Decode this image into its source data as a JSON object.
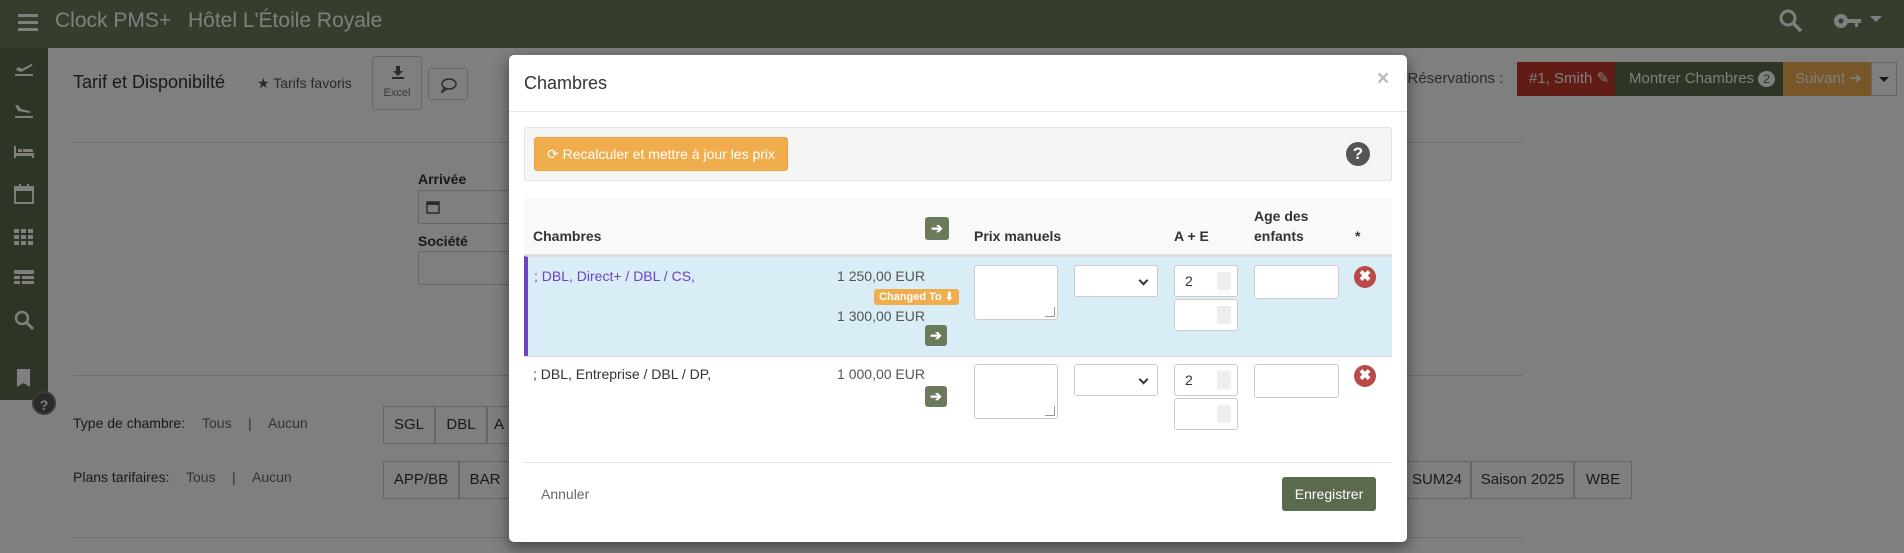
{
  "app": {
    "name": "Clock PMS+",
    "hotel": "Hôtel L'Étoile Royale"
  },
  "page": {
    "title": "Tarif et Disponibilté",
    "favorites_label": "Tarifs favoris",
    "excel_label": "Excel",
    "arrival_label": "Arrivée",
    "company_label": "Société",
    "room_type_label": "Type de chambre:",
    "rate_plans_label": "Plans tarifaires:",
    "all_label": "Tous",
    "none_label": "Aucun",
    "separator": "|",
    "room_types": [
      "SGL",
      "DBL",
      "A"
    ],
    "rate_plans_left": [
      "APP/BB",
      "BAR"
    ],
    "rate_plans_right": [
      "SUM24",
      "Saison 2025",
      "WBE"
    ],
    "reservations_label": "e Réservations :",
    "reservation_chip": "#1, Smith",
    "show_rooms_label": "Montrer Chambres",
    "show_rooms_count": "2",
    "next_label": "Suivant"
  },
  "modal": {
    "title": "Chambres",
    "close": "×",
    "recalc_label": "Recalculer et mettre à jour les prix",
    "help": "?",
    "headers": {
      "rooms": "Chambres",
      "manual_price": "Prix manuels",
      "adults_children": "A + E",
      "children_age_1": "Age des",
      "children_age_2": "enfants",
      "star": "*"
    },
    "rows": [
      {
        "name": "; DBL, Direct+ / DBL / CS,",
        "price": "1 250,00 EUR",
        "badge": "Changed To",
        "new_price": "1 300,00 EUR",
        "adults": "2"
      },
      {
        "name": "; DBL, Entreprise / DBL / DP,",
        "price": "1 000,00 EUR",
        "adults": "2"
      }
    ],
    "cancel_label": "Annuler",
    "save_label": "Enregistrer"
  },
  "colors": {
    "topbar": "#6b7a5a",
    "accent_orange": "#f0ad4e",
    "highlight_row": "#d9edf7",
    "row_border": "#6f42c1",
    "delete_red": "#b94a48"
  }
}
